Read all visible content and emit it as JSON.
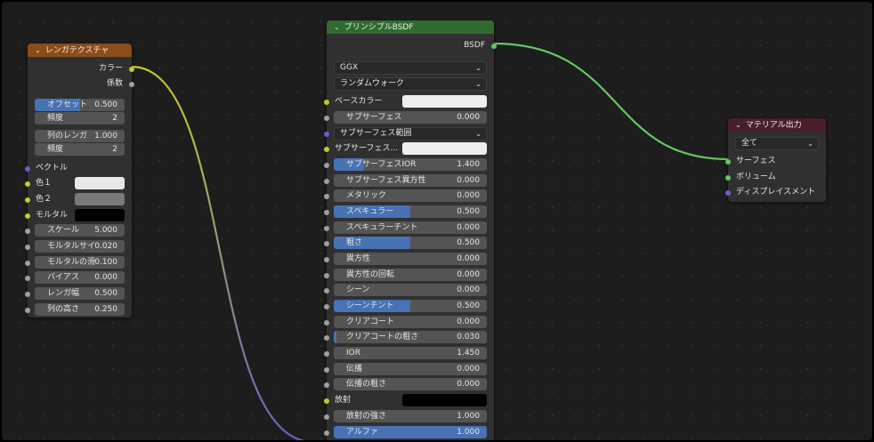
{
  "colors": {
    "yellow": "#c7c729",
    "gray": "#a1a1a1",
    "purple": "#6363c7",
    "green": "#63c763",
    "blue": "#4772b3"
  },
  "brick": {
    "title": "レンガテクスチャ",
    "header_color": "#8a4d1a",
    "rows": [
      {
        "type": "out",
        "label": "カラー",
        "sock": "yellow"
      },
      {
        "type": "out",
        "label": "係数",
        "sock": "gray"
      },
      {
        "type": "slider",
        "label": "オフセット",
        "value": "0.500",
        "fill": 0.5
      },
      {
        "type": "slider",
        "label": "頻度",
        "value": "2",
        "fill": 0
      },
      {
        "type": "slider",
        "label": "列のレンガ",
        "value": "1.000",
        "fill": 0
      },
      {
        "type": "slider",
        "label": "頻度",
        "value": "2",
        "fill": 0
      },
      {
        "type": "in",
        "label": "ベクトル",
        "sock": "purple"
      },
      {
        "type": "color",
        "label": "色１",
        "sock": "yellow",
        "swatch": "#e8e8e8"
      },
      {
        "type": "color",
        "label": "色２",
        "sock": "yellow",
        "swatch": "#7a7a7a"
      },
      {
        "type": "color",
        "label": "モルタル",
        "sock": "yellow",
        "swatch": "#000000"
      },
      {
        "type": "slider",
        "label": "スケール",
        "value": "5.000",
        "fill": 0,
        "sock": "gray"
      },
      {
        "type": "slider",
        "label": "モルタルサイ",
        "value": "0.020",
        "fill": 0,
        "sock": "gray"
      },
      {
        "type": "slider",
        "label": "モルタルの滑",
        "value": "0.100",
        "fill": 0,
        "sock": "gray"
      },
      {
        "type": "slider",
        "label": "バイアス",
        "value": "0.000",
        "fill": 0,
        "sock": "gray"
      },
      {
        "type": "slider",
        "label": "レンガ幅",
        "value": "0.500",
        "fill": 0,
        "sock": "gray"
      },
      {
        "type": "slider",
        "label": "列の高さ",
        "value": "0.250",
        "fill": 0,
        "sock": "gray"
      }
    ]
  },
  "bsdf": {
    "title": "プリンシプルBSDF",
    "header_color": "#2f6b2f",
    "rows": [
      {
        "type": "out",
        "label": "BSDF",
        "sock": "green"
      },
      {
        "type": "select",
        "label": "GGX"
      },
      {
        "type": "select",
        "label": "ランダムウォーク"
      },
      {
        "type": "color",
        "label": "ベースカラー",
        "sock": "yellow",
        "swatch": "#eeeeee"
      },
      {
        "type": "slider",
        "label": "サブサーフェス",
        "value": "0.000",
        "fill": 0,
        "sock": "gray"
      },
      {
        "type": "select",
        "label": "サブサーフェス範囲",
        "sock": "purple"
      },
      {
        "type": "color",
        "label": "サブサーフェス...",
        "sock": "yellow",
        "swatch": "#eeeeee"
      },
      {
        "type": "slider",
        "label": "サブサーフェスIOR",
        "value": "1.400",
        "fill": 0.2,
        "sock": "gray"
      },
      {
        "type": "slider",
        "label": "サブサーフェス異方性",
        "value": "0.000",
        "fill": 0,
        "sock": "gray"
      },
      {
        "type": "slider",
        "label": "メタリック",
        "value": "0.000",
        "fill": 0,
        "sock": "gray"
      },
      {
        "type": "slider",
        "label": "スペキュラー",
        "value": "0.500",
        "fill": 0.5,
        "sock": "gray"
      },
      {
        "type": "slider",
        "label": "スペキュラーチント",
        "value": "0.000",
        "fill": 0,
        "sock": "gray"
      },
      {
        "type": "slider",
        "label": "粗さ",
        "value": "0.500",
        "fill": 0.5,
        "sock": "gray"
      },
      {
        "type": "slider",
        "label": "異方性",
        "value": "0.000",
        "fill": 0,
        "sock": "gray"
      },
      {
        "type": "slider",
        "label": "異方性の回転",
        "value": "0.000",
        "fill": 0,
        "sock": "gray"
      },
      {
        "type": "slider",
        "label": "シーン",
        "value": "0.000",
        "fill": 0,
        "sock": "gray"
      },
      {
        "type": "slider",
        "label": "シーンチント",
        "value": "0.500",
        "fill": 0.5,
        "sock": "gray"
      },
      {
        "type": "slider",
        "label": "クリアコート",
        "value": "0.000",
        "fill": 0,
        "sock": "gray"
      },
      {
        "type": "slider",
        "label": "クリアコートの粗さ",
        "value": "0.030",
        "fill": 0.015,
        "sock": "gray"
      },
      {
        "type": "slider",
        "label": "IOR",
        "value": "1.450",
        "fill": 0,
        "sock": "gray"
      },
      {
        "type": "slider",
        "label": "伝播",
        "value": "0.000",
        "fill": 0,
        "sock": "gray"
      },
      {
        "type": "slider",
        "label": "伝播の粗さ",
        "value": "0.000",
        "fill": 0,
        "sock": "gray"
      },
      {
        "type": "color",
        "label": "放射",
        "sock": "yellow",
        "swatch": "#000000"
      },
      {
        "type": "slider",
        "label": "放射の強さ",
        "value": "1.000",
        "fill": 0,
        "sock": "gray"
      },
      {
        "type": "slider",
        "label": "アルファ",
        "value": "1.000",
        "fill": 1,
        "sock": "gray"
      }
    ]
  },
  "output": {
    "title": "マテリアル出力",
    "header_color": "#4a1f2a",
    "rows": [
      {
        "type": "select",
        "label": "全て"
      },
      {
        "type": "in",
        "label": "サーフェス",
        "sock": "green"
      },
      {
        "type": "in",
        "label": "ボリューム",
        "sock": "green"
      },
      {
        "type": "in",
        "label": "ディスプレイスメント",
        "sock": "purple"
      }
    ]
  }
}
